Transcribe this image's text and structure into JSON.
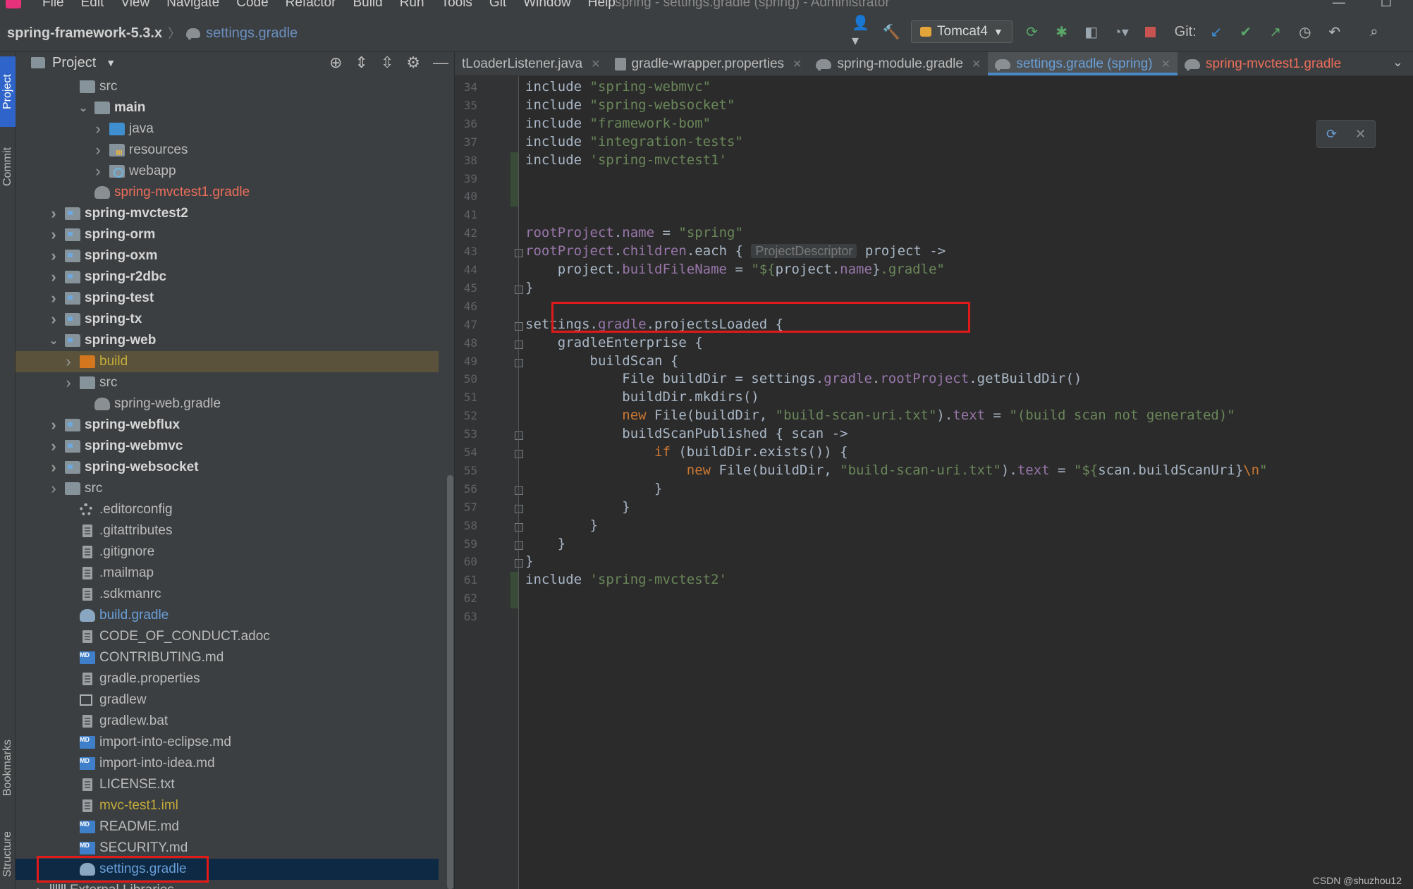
{
  "menubar": {
    "items": [
      "File",
      "Edit",
      "View",
      "Navigate",
      "Code",
      "Refactor",
      "Build",
      "Run",
      "Tools",
      "Git",
      "Window",
      "Help"
    ],
    "window_title": "spring - settings.gradle (spring) - Administrator"
  },
  "navbar": {
    "project": "spring-framework-5.3.x",
    "file": "settings.gradle",
    "run_config": "Tomcat4",
    "git_label": "Git:"
  },
  "tool_stripe": [
    "Project",
    "Commit",
    "Bookmarks",
    "Structure"
  ],
  "project_panel": {
    "title": "Project",
    "tree": [
      {
        "label": "src",
        "indent": 3,
        "arrow": "",
        "icon": "folder",
        "style": ""
      },
      {
        "label": "main",
        "indent": 4,
        "arrow": "down",
        "icon": "folder",
        "style": "bold"
      },
      {
        "label": "java",
        "indent": 5,
        "arrow": "right",
        "icon": "folder-blue",
        "style": ""
      },
      {
        "label": "resources",
        "indent": 5,
        "arrow": "right",
        "icon": "folder-res",
        "style": ""
      },
      {
        "label": "webapp",
        "indent": 5,
        "arrow": "right",
        "icon": "folder-web",
        "style": ""
      },
      {
        "label": "spring-mvctest1.gradle",
        "indent": 4,
        "arrow": "",
        "icon": "gradle",
        "style": "red"
      },
      {
        "label": "spring-mvctest2",
        "indent": 2,
        "arrow": "right",
        "icon": "folder-module",
        "style": "bold"
      },
      {
        "label": "spring-orm",
        "indent": 2,
        "arrow": "right",
        "icon": "folder-module",
        "style": "bold"
      },
      {
        "label": "spring-oxm",
        "indent": 2,
        "arrow": "right",
        "icon": "folder-module",
        "style": "bold"
      },
      {
        "label": "spring-r2dbc",
        "indent": 2,
        "arrow": "right",
        "icon": "folder-module",
        "style": "bold"
      },
      {
        "label": "spring-test",
        "indent": 2,
        "arrow": "right",
        "icon": "folder-module",
        "style": "bold"
      },
      {
        "label": "spring-tx",
        "indent": 2,
        "arrow": "right",
        "icon": "folder-module",
        "style": "bold"
      },
      {
        "label": "spring-web",
        "indent": 2,
        "arrow": "down",
        "icon": "folder-module",
        "style": "bold"
      },
      {
        "label": "build",
        "indent": 3,
        "arrow": "right",
        "icon": "folder-orange",
        "style": "yellow buildsel"
      },
      {
        "label": "src",
        "indent": 3,
        "arrow": "right",
        "icon": "folder",
        "style": ""
      },
      {
        "label": "spring-web.gradle",
        "indent": 4,
        "arrow": "",
        "icon": "gradle",
        "style": ""
      },
      {
        "label": "spring-webflux",
        "indent": 2,
        "arrow": "right",
        "icon": "folder-module",
        "style": "bold"
      },
      {
        "label": "spring-webmvc",
        "indent": 2,
        "arrow": "right",
        "icon": "folder-module",
        "style": "bold"
      },
      {
        "label": "spring-websocket",
        "indent": 2,
        "arrow": "right",
        "icon": "folder-module",
        "style": "bold"
      },
      {
        "label": "src",
        "indent": 2,
        "arrow": "right",
        "icon": "folder",
        "style": ""
      },
      {
        "label": ".editorconfig",
        "indent": 3,
        "arrow": "",
        "icon": "gear",
        "style": ""
      },
      {
        "label": ".gitattributes",
        "indent": 3,
        "arrow": "",
        "icon": "doc",
        "style": ""
      },
      {
        "label": ".gitignore",
        "indent": 3,
        "arrow": "",
        "icon": "doc",
        "style": ""
      },
      {
        "label": ".mailmap",
        "indent": 3,
        "arrow": "",
        "icon": "doc",
        "style": ""
      },
      {
        "label": ".sdkmanrc",
        "indent": 3,
        "arrow": "",
        "icon": "doc",
        "style": ""
      },
      {
        "label": "build.gradle",
        "indent": 3,
        "arrow": "",
        "icon": "gradle",
        "style": "blue"
      },
      {
        "label": "CODE_OF_CONDUCT.adoc",
        "indent": 3,
        "arrow": "",
        "icon": "doc",
        "style": ""
      },
      {
        "label": "CONTRIBUTING.md",
        "indent": 3,
        "arrow": "",
        "icon": "md",
        "style": ""
      },
      {
        "label": "gradle.properties",
        "indent": 3,
        "arrow": "",
        "icon": "doc",
        "style": ""
      },
      {
        "label": "gradlew",
        "indent": 3,
        "arrow": "",
        "icon": "term",
        "style": ""
      },
      {
        "label": "gradlew.bat",
        "indent": 3,
        "arrow": "",
        "icon": "doc",
        "style": ""
      },
      {
        "label": "import-into-eclipse.md",
        "indent": 3,
        "arrow": "",
        "icon": "md",
        "style": ""
      },
      {
        "label": "import-into-idea.md",
        "indent": 3,
        "arrow": "",
        "icon": "md",
        "style": ""
      },
      {
        "label": "LICENSE.txt",
        "indent": 3,
        "arrow": "",
        "icon": "doc",
        "style": ""
      },
      {
        "label": "mvc-test1.iml",
        "indent": 3,
        "arrow": "",
        "icon": "doc",
        "style": "yellow"
      },
      {
        "label": "README.md",
        "indent": 3,
        "arrow": "",
        "icon": "md",
        "style": ""
      },
      {
        "label": "SECURITY.md",
        "indent": 3,
        "arrow": "",
        "icon": "md",
        "style": ""
      },
      {
        "label": "settings.gradle",
        "indent": 3,
        "arrow": "",
        "icon": "gradle",
        "style": "blue sel boxed"
      },
      {
        "label": "External Libraries",
        "indent": 1,
        "arrow": "right",
        "icon": "bars",
        "style": ""
      }
    ]
  },
  "editor_tabs": [
    {
      "label": "tLoaderListener.java",
      "state": "normal",
      "icon": false
    },
    {
      "label": "gradle-wrapper.properties",
      "state": "normal",
      "icon": true
    },
    {
      "label": "spring-module.gradle",
      "state": "normal",
      "icon": true
    },
    {
      "label": "settings.gradle (spring)",
      "state": "active",
      "icon": true
    },
    {
      "label": "spring-mvctest1.gradle",
      "state": "red",
      "icon": true
    }
  ],
  "editor": {
    "first_line": 34,
    "lines": [
      [
        [
          "include ",
          ""
        ],
        [
          "\"spring-webmvc\"",
          "s"
        ]
      ],
      [
        [
          "include ",
          ""
        ],
        [
          "\"spring-websocket\"",
          "s"
        ]
      ],
      [
        [
          "include ",
          ""
        ],
        [
          "\"framework-bom\"",
          "s"
        ]
      ],
      [
        [
          "include ",
          ""
        ],
        [
          "\"integration-tests\"",
          "s"
        ]
      ],
      [
        [
          "include ",
          ""
        ],
        [
          "'spring-mvctest1'",
          "s"
        ]
      ],
      [],
      [],
      [],
      [
        [
          "rootProject",
          "p"
        ],
        [
          ".",
          ""
        ],
        [
          "name",
          "p"
        ],
        [
          " = ",
          ""
        ],
        [
          "\"spring\"",
          "s"
        ]
      ],
      [
        [
          "rootProject",
          "p"
        ],
        [
          ".",
          ""
        ],
        [
          "children",
          "p"
        ],
        [
          ".each { ",
          ""
        ],
        [
          "ProjectDescriptor",
          "hint"
        ],
        [
          " project ->",
          ""
        ]
      ],
      [
        [
          "    project.",
          ""
        ],
        [
          "buildFileName",
          "p"
        ],
        [
          " = ",
          ""
        ],
        [
          "\"${",
          "s"
        ],
        [
          "project.",
          ""
        ],
        [
          "name",
          "p"
        ],
        [
          "}",
          ""
        ],
        [
          ".gradle\"",
          "s"
        ]
      ],
      [
        [
          "}",
          ""
        ]
      ],
      [],
      [
        [
          "settings.",
          ""
        ],
        [
          "gradle",
          "p"
        ],
        [
          ".projectsLoaded {",
          ""
        ]
      ],
      [
        [
          "    gradleEnterprise {",
          ""
        ]
      ],
      [
        [
          "        buildScan {",
          ""
        ]
      ],
      [
        [
          "            File buildDir = settings.",
          ""
        ],
        [
          "gradle",
          "p"
        ],
        [
          ".",
          ""
        ],
        [
          "rootProject",
          "p"
        ],
        [
          ".getBuildDir()",
          ""
        ]
      ],
      [
        [
          "            buildDir.mkdirs()",
          ""
        ]
      ],
      [
        [
          "            ",
          ""
        ],
        [
          "new ",
          "k"
        ],
        [
          "File(buildDir, ",
          ""
        ],
        [
          "\"build-scan-uri.txt\"",
          "s"
        ],
        [
          ").",
          ""
        ],
        [
          "text",
          "p"
        ],
        [
          " = ",
          ""
        ],
        [
          "\"(build scan not generated)\"",
          "s"
        ]
      ],
      [
        [
          "            buildScanPublished { scan ->",
          ""
        ]
      ],
      [
        [
          "                ",
          ""
        ],
        [
          "if ",
          "k"
        ],
        [
          "(buildDir.exists()) {",
          ""
        ]
      ],
      [
        [
          "                    ",
          ""
        ],
        [
          "new ",
          "k"
        ],
        [
          "File(buildDir, ",
          ""
        ],
        [
          "\"build-scan-uri.txt\"",
          "s"
        ],
        [
          ").",
          ""
        ],
        [
          "text",
          "p"
        ],
        [
          " = ",
          ""
        ],
        [
          "\"${",
          "s"
        ],
        [
          "scan.buildScanUri",
          ""
        ],
        [
          "}",
          ""
        ],
        [
          "\\n",
          "k"
        ],
        [
          "\"",
          "s"
        ]
      ],
      [
        [
          "                }",
          ""
        ]
      ],
      [
        [
          "            }",
          ""
        ]
      ],
      [
        [
          "        }",
          ""
        ]
      ],
      [
        [
          "    }",
          ""
        ]
      ],
      [
        [
          "}",
          ""
        ]
      ],
      [
        [
          "include ",
          ""
        ],
        [
          "'spring-mvctest2'",
          "s"
        ]
      ],
      [],
      []
    ]
  },
  "watermark": "CSDN @shuzhou12",
  "colors": {
    "highlight_box": "#e01919",
    "keyword": "#cc7832",
    "string": "#6a8759",
    "property": "#9876aa",
    "text": "#a9b7c6"
  }
}
